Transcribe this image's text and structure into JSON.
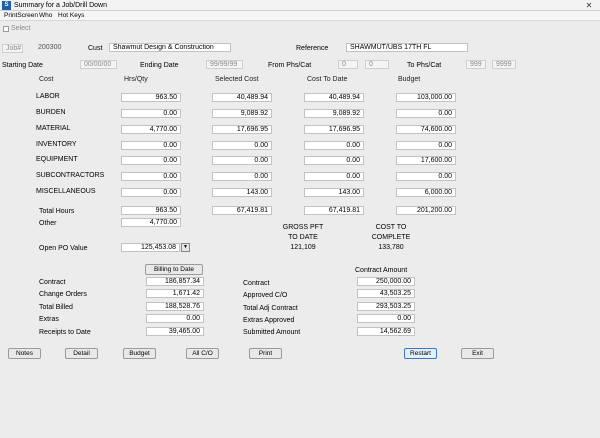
{
  "window": {
    "title": "Summary for a Job/Drill Down",
    "close_glyph": "✕"
  },
  "menu": {
    "printscreen": "PrintScreen",
    "who": "Who",
    "hotkeys": "Hot Keys"
  },
  "select_label": "Select",
  "job": {
    "label": "Job#",
    "number": "200300"
  },
  "cust": {
    "label": "Cust",
    "value": "Shawmut Design & Construction"
  },
  "reference": {
    "label": "Reference",
    "value": "SHAWMUT/UBS 17TH FL"
  },
  "dates": {
    "starting_label": "Starting Date",
    "starting_value": "00/00/00",
    "ending_label": "Ending Date",
    "ending_value": "99/99/99",
    "from_label": "From Phs/Cat",
    "from_phase": "0",
    "from_cat": "0",
    "to_label": "To Phs/Cat",
    "to_phase": "999",
    "to_cat": "9999"
  },
  "headers": {
    "cost": "Cost",
    "hrs_qty": "Hrs/Qty",
    "selected_cost": "Selected Cost",
    "cost_to_date": "Cost To Date",
    "budget": "Budget"
  },
  "rows": [
    {
      "label": "LABOR",
      "hrs": "963.50",
      "selected": "40,489.94",
      "to_date": "40,489.94",
      "budget": "103,000.00"
    },
    {
      "label": "BURDEN",
      "hrs": "0.00",
      "selected": "9,089.92",
      "to_date": "9,089.92",
      "budget": "0.00"
    },
    {
      "label": "MATERIAL",
      "hrs": "4,770.00",
      "selected": "17,696.95",
      "to_date": "17,696.95",
      "budget": "74,600.00"
    },
    {
      "label": "INVENTORY",
      "hrs": "0.00",
      "selected": "0.00",
      "to_date": "0.00",
      "budget": "0.00"
    },
    {
      "label": "EQUIPMENT",
      "hrs": "0.00",
      "selected": "0.00",
      "to_date": "0.00",
      "budget": "17,600.00"
    },
    {
      "label": "SUBCONTRACTORS",
      "hrs": "0.00",
      "selected": "0.00",
      "to_date": "0.00",
      "budget": "0.00"
    },
    {
      "label": "MISCELLANEOUS",
      "hrs": "0.00",
      "selected": "143.00",
      "to_date": "143.00",
      "budget": "6,000.00"
    }
  ],
  "totals": {
    "label": "Total Hours",
    "hrs": "963.50",
    "selected": "67,419.81",
    "to_date": "67,419.81",
    "budget": "201,200.00"
  },
  "other": {
    "label": "Other",
    "value": "4,770.00"
  },
  "open_po": {
    "label": "Open PO Value",
    "value": "125,453.08",
    "arrow": "▼"
  },
  "gross_pft": {
    "line1": "GROSS PFT",
    "line2": "TO DATE",
    "value": "121,109"
  },
  "cost_complete": {
    "line1": "COST TO",
    "line2": "COMPLETE",
    "value": "133,780"
  },
  "billing": {
    "button": "Billing to Date",
    "items": [
      {
        "label": "Contract",
        "value": "186,857.34"
      },
      {
        "label": "Change Orders",
        "value": "1,671.42"
      },
      {
        "label": "Total Billed",
        "value": "188,528.76"
      },
      {
        "label": "Extras",
        "value": "0.00"
      },
      {
        "label": "Receipts to Date",
        "value": "39,465.00"
      }
    ]
  },
  "contract_amount": {
    "title": "Contract Amount",
    "items": [
      {
        "label": "Contract",
        "value": "250,000.00"
      },
      {
        "label": "Approved C/O",
        "value": "43,503.25"
      },
      {
        "label": "Total Adj Contract",
        "value": "293,503.25"
      },
      {
        "label": "Extras Approved",
        "value": "0.00"
      },
      {
        "label": "Submitted Amount",
        "value": "14,562.69"
      }
    ]
  },
  "buttons": {
    "notes": "Notes",
    "detail": "Detail",
    "budget": "Budget",
    "all_co": "All C/O",
    "print": "Print",
    "restart": "Restart",
    "exit": "Exit"
  }
}
